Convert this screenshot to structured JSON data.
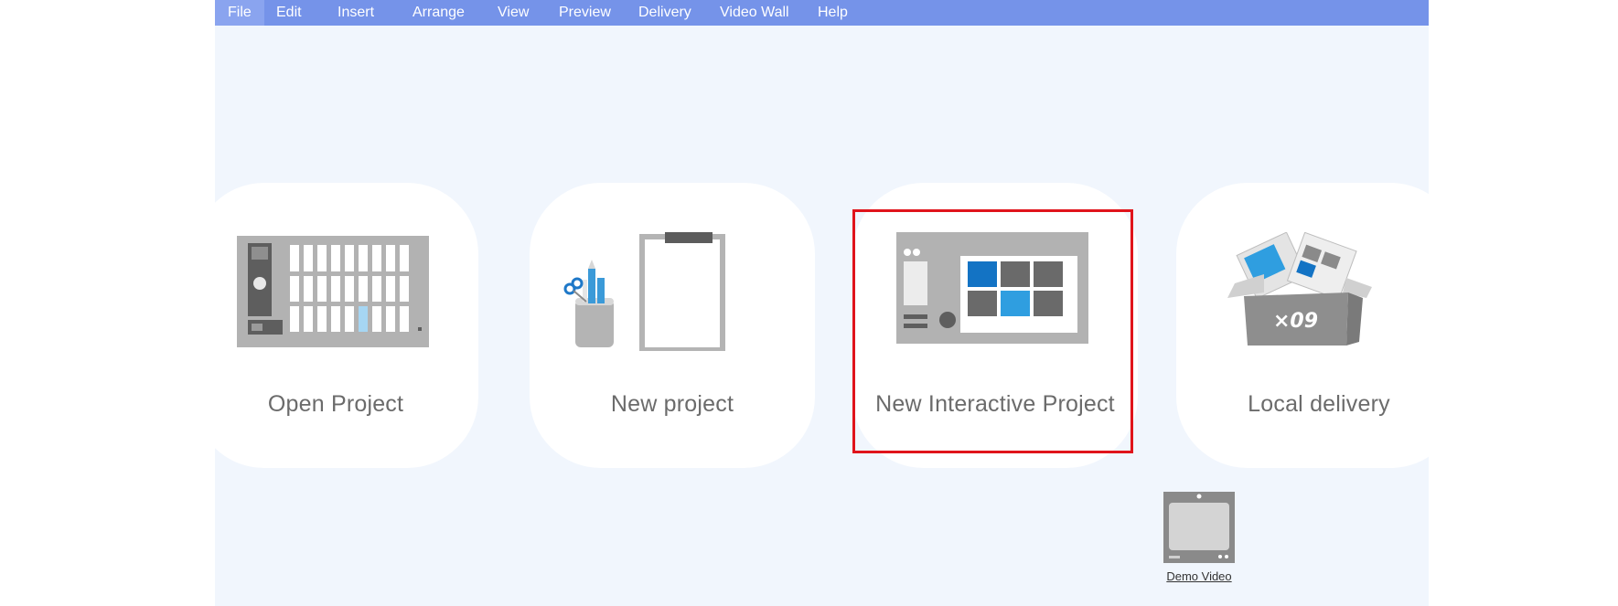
{
  "menubar": {
    "items": [
      {
        "label": "File"
      },
      {
        "label": "Edit"
      },
      {
        "label": "Insert"
      },
      {
        "label": "Arrange"
      },
      {
        "label": "View"
      },
      {
        "label": "Preview"
      },
      {
        "label": "Delivery"
      },
      {
        "label": "Video Wall"
      },
      {
        "label": "Help"
      }
    ]
  },
  "cards": [
    {
      "label": "Open Project",
      "icon": "project-grid-icon"
    },
    {
      "label": "New project",
      "icon": "clipboard-icon"
    },
    {
      "label": "New Interactive Project",
      "icon": "interactive-layout-icon"
    },
    {
      "label": "Local delivery",
      "icon": "delivery-box-icon"
    }
  ],
  "demo": {
    "label": "Demo Video",
    "icon": "video-screen-icon"
  },
  "colors": {
    "menubar": "#7593e9",
    "background": "#f1f6fd",
    "card": "#ffffff",
    "highlight": "#e0141b",
    "accent_blue": "#2f9ee0",
    "dark_blue": "#1373c4"
  }
}
